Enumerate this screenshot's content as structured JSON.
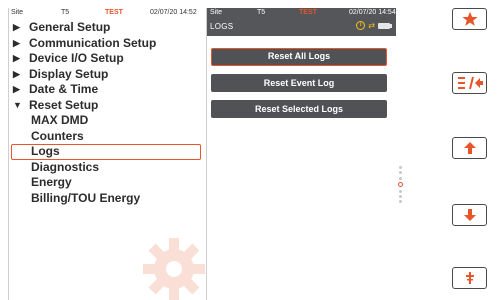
{
  "left_status": {
    "site": "Site",
    "feeder": "T5",
    "mode": "TEST",
    "datetime": "02/07/20 14:52"
  },
  "tree": [
    {
      "label": "General Setup",
      "kind": "top",
      "expanded": false
    },
    {
      "label": "Communication Setup",
      "kind": "top",
      "expanded": false
    },
    {
      "label": "Device I/O Setup",
      "kind": "top",
      "expanded": false
    },
    {
      "label": "Display Setup",
      "kind": "top",
      "expanded": false
    },
    {
      "label": "Date & Time",
      "kind": "top",
      "expanded": false
    },
    {
      "label": "Reset Setup",
      "kind": "top",
      "expanded": true
    },
    {
      "label": "MAX DMD",
      "kind": "sub"
    },
    {
      "label": "Counters",
      "kind": "sub"
    },
    {
      "label": "Logs",
      "kind": "sub",
      "selected": true
    },
    {
      "label": "Diagnostics",
      "kind": "sub"
    },
    {
      "label": "Energy",
      "kind": "sub"
    },
    {
      "label": "Billing/TOU Energy",
      "kind": "sub"
    }
  ],
  "mid_status": {
    "site": "Site",
    "feeder": "T5",
    "mode": "TEST",
    "datetime": "02/07/20 14:54"
  },
  "mid_title": "LOGS",
  "buttons": {
    "reset_all_logs": "Reset All Logs",
    "reset_event_log": "Reset Event Log",
    "reset_selected_logs": "Reset Selected Logs"
  },
  "scroll": {
    "total": 7,
    "active_index": 3
  },
  "side_buttons": [
    "star-icon",
    "menu-back-icon",
    "up-arrow-icon",
    "down-arrow-icon",
    "tools-icon"
  ],
  "colors": {
    "accent": "#e8552a",
    "header": "#54565a",
    "button": "#505256",
    "icon_warn": "#f5c218"
  }
}
